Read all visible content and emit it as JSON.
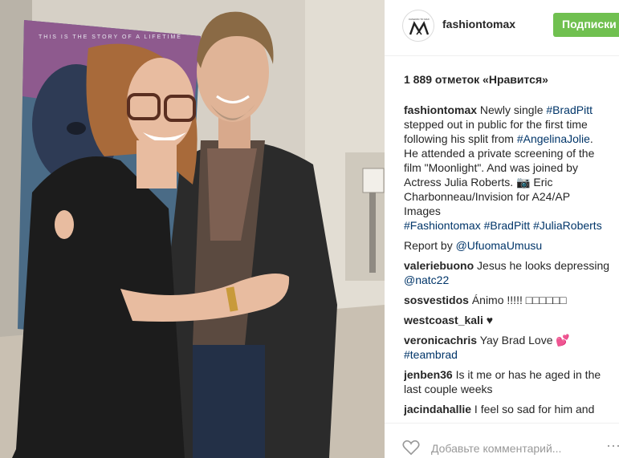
{
  "post": {
    "username": "fashiontomax",
    "follow_label": "Подписки",
    "likes_text": "1 889 отметок «Нравится»",
    "caption": {
      "user": "fashiontomax",
      "lines": [
        [
          {
            "t": "Newly single "
          },
          {
            "t": "#BradPitt",
            "tag": true
          }
        ],
        [
          {
            "t": "stepped out in public for the first time"
          }
        ],
        [
          {
            "t": "following his split from "
          },
          {
            "t": "#AngelinaJolie",
            "tag": true
          },
          {
            "t": "."
          }
        ],
        [
          {
            "t": "He attended a private screening of the"
          }
        ],
        [
          {
            "t": "film \"Moonlight\". And was joined by"
          }
        ],
        [
          {
            "t": "Actress Julia Roberts. 📷 Eric"
          }
        ],
        [
          {
            "t": "Charbonneau/Invision for A24/AP"
          }
        ],
        [
          {
            "t": "Images"
          }
        ],
        [
          {
            "t": "#Fashiontomax",
            "tag": true
          },
          {
            "t": " "
          },
          {
            "t": "#BradPitt",
            "tag": true
          },
          {
            "t": " "
          },
          {
            "t": "#JuliaRoberts",
            "tag": true
          }
        ]
      ]
    },
    "report": {
      "prefix": "Report by ",
      "mention": "@UfuomaUmusu"
    },
    "comments": [
      {
        "user": "valeriebuono",
        "text": " Jesus he looks depressing ",
        "tag": "@natc22"
      },
      {
        "user": "sosvestidos",
        "text": " Ánimo !!!!! □□□□□□",
        "tag": ""
      },
      {
        "user": "westcoast_kali",
        "text": " ♥",
        "tag": ""
      },
      {
        "user": "veronicachris",
        "text": " Yay Brad Love 💕 ",
        "tag": "#teambrad"
      },
      {
        "user": "jenben36",
        "text": " Is it me or has he aged in the last couple weeks",
        "tag": ""
      },
      {
        "user": "jacindahallie",
        "text": " I feel so sad for him and",
        "tag": ""
      }
    ],
    "add_comment_placeholder": "Добавьте комментарий...",
    "poster_text": "THIS IS THE STORY OF A LIFETIME",
    "avatar_text": "FASHION TO MAX"
  },
  "icons": {
    "heart": "heart-outline-icon",
    "more": "more-dots-icon"
  }
}
